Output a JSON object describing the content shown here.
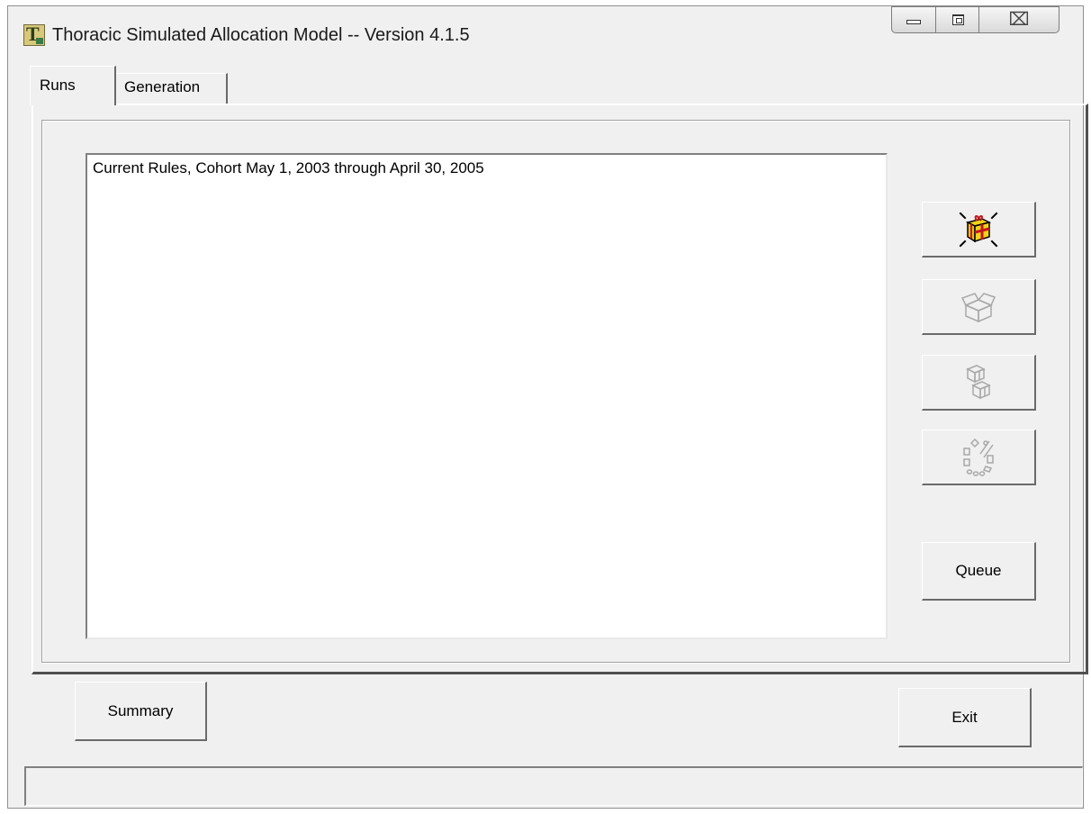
{
  "window": {
    "title": "Thoracic Simulated Allocation Model -- Version 4.1.5",
    "icon": "thoracic-app-icon",
    "icon_letter": "T"
  },
  "caption_buttons": {
    "minimize_icon": "minimize-icon",
    "maximize_icon": "maximize-icon",
    "close_icon": "close-icon",
    "close_glyph": "⌧"
  },
  "tabs": [
    {
      "label": "Runs",
      "active": true
    },
    {
      "label": "Generation",
      "active": false
    }
  ],
  "runs_list": {
    "items": [
      "Current Rules, Cohort May 1, 2003 through April 30, 2005"
    ]
  },
  "side_buttons": [
    {
      "icon": "gift-box-run-icon",
      "enabled": true
    },
    {
      "icon": "open-box-icon",
      "enabled": false
    },
    {
      "icon": "multiple-boxes-icon",
      "enabled": false
    },
    {
      "icon": "batch-parts-icon",
      "enabled": false
    }
  ],
  "buttons": {
    "queue_label": "Queue",
    "summary_label": "Summary",
    "exit_label": "Exit"
  },
  "status_bar": {
    "text": ""
  },
  "colors": {
    "window_bg": "#f0f0f0",
    "gift_yellow": "#f2d21a",
    "gift_red": "#c4161c",
    "disabled_gray": "#a8a8a8"
  }
}
